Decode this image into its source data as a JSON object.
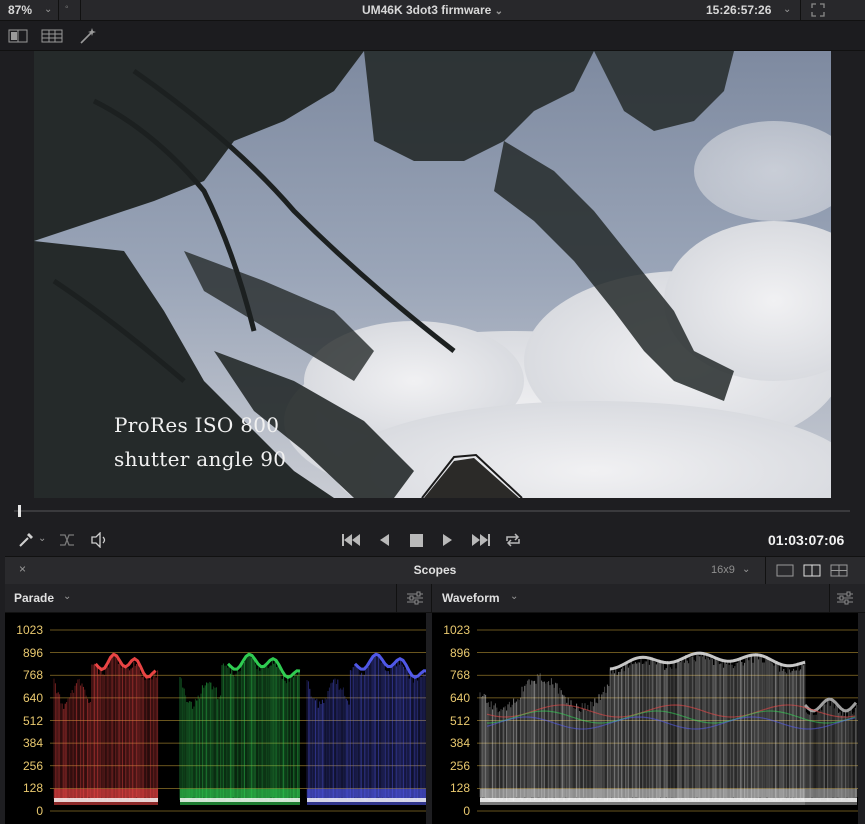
{
  "top_bar": {
    "zoom_value": "87%",
    "clip_title": "UM46K 3dot3 firmware",
    "clock": "15:26:57:26"
  },
  "viewer": {
    "caption_line1": "ProRes   ISO 800",
    "caption_line2": "shutter angle 90"
  },
  "transport": {
    "timecode": "01:03:07:06",
    "playhead_position": 0.005
  },
  "scopes": {
    "panel_title": "Scopes",
    "aspect_label": "16x9",
    "left_scope": "Parade",
    "right_scope": "Waveform",
    "y_axis_ticks": [
      "1023",
      "896",
      "768",
      "640",
      "512",
      "384",
      "256",
      "128",
      "0"
    ],
    "colors": {
      "red": "#ff4a4a",
      "green": "#34e05a",
      "blue": "#5860ff",
      "grid": "#c9a33b",
      "label": "#e9c96f"
    }
  }
}
